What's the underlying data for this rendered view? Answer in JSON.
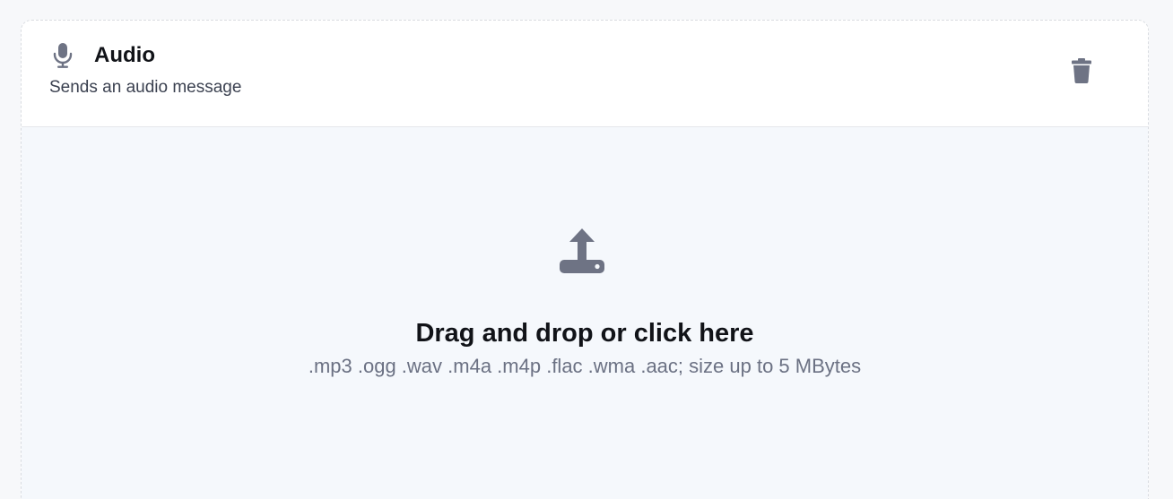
{
  "block": {
    "title": "Audio",
    "subtitle": "Sends an audio message",
    "icon": "microphone-icon",
    "delete_icon": "trash-icon"
  },
  "dropzone": {
    "icon": "upload-icon",
    "title": "Drag and drop or click here",
    "hint": ".mp3 .ogg .wav .m4a .m4p .flac .wma .aac; size up to 5 MBytes"
  },
  "colors": {
    "icon_gray": "#6e7384",
    "dropzone_bg": "#f5f8fc",
    "page_bg": "#f7f8fa",
    "title_text": "#111318",
    "hint_text": "#6b7183"
  }
}
